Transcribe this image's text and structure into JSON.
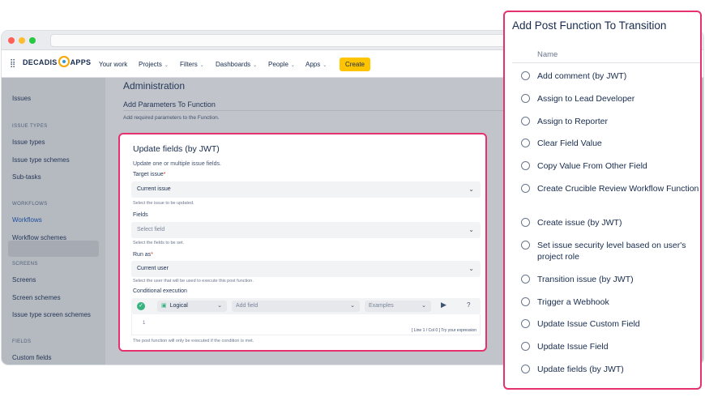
{
  "nav": {
    "brand": "DECADIS",
    "brand_suffix": "APPS",
    "items": [
      "Your work",
      "Projects",
      "Filters",
      "Dashboards",
      "People",
      "Apps"
    ],
    "create_label": "Create"
  },
  "sidebar": {
    "issues": "Issues",
    "issue_types_head": "ISSUE TYPES",
    "issue_types": "Issue types",
    "issue_type_schemes": "Issue type schemes",
    "sub_tasks": "Sub-tasks",
    "workflows_head": "WORKFLOWS",
    "workflows": "Workflows",
    "workflow_schemes": "Workflow schemes",
    "screens_head": "SCREENS",
    "screens": "Screens",
    "screen_schemes": "Screen schemes",
    "issue_type_screen_schemes": "Issue type screen schemes",
    "fields_head": "FIELDS",
    "custom_fields": "Custom fields"
  },
  "main": {
    "admin_title": "Administration",
    "section_title": "Add Parameters To Function",
    "section_sub": "Add required parameters to the Function."
  },
  "form": {
    "title": "Update fields (by JWT)",
    "desc": "Update one or multiple issue fields.",
    "target_label": "Target issue",
    "target_value": "Current issue",
    "target_help": "Select the issue to be updated.",
    "fields_label": "Fields",
    "fields_placeholder": "Select field",
    "fields_help": "Select the fields to be set.",
    "runas_label": "Run as",
    "runas_value": "Current user",
    "runas_help": "Select the user that will be used to execute this post function.",
    "cond_label": "Conditional execution",
    "cond_logical": "Logical",
    "cond_add_field": "Add field",
    "cond_examples": "Examples",
    "cond_help": "?",
    "code_line_no": "1",
    "code_status": "[ Line 1 / Col 0 ]   Try your expression",
    "footer": "The post function will only be executed if the condition is met."
  },
  "panel": {
    "title": "Add Post Function To Transition",
    "col_head": "Name",
    "options": [
      "Add comment (by JWT)",
      "Assign to Lead Developer",
      "Assign to Reporter",
      "Clear Field Value",
      "Copy Value From Other Field",
      "Create Crucible Review Workflow Function",
      "Create issue (by JWT)",
      "Set issue security level based on user's project role",
      "Transition issue (by JWT)",
      "Trigger a Webhook",
      "Update Issue Custom Field",
      "Update Issue Field",
      "Update fields (by JWT)"
    ]
  },
  "colors": {
    "highlight": "#e5316e",
    "create_button": "#ffc400",
    "ok_badge": "#36b37e"
  }
}
